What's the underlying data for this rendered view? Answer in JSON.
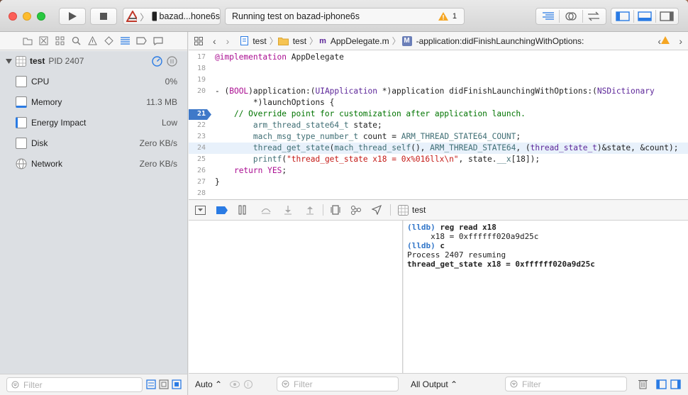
{
  "toolbar": {
    "scheme_target": "bazad...hone6s",
    "activity_text": "Running test on bazad-iphone6s",
    "warning_count": "1"
  },
  "navigator": {
    "process": {
      "name": "test",
      "pid": "PID 2407"
    },
    "gauges": [
      {
        "label": "CPU",
        "value": "0%"
      },
      {
        "label": "Memory",
        "value": "11.3 MB"
      },
      {
        "label": "Energy Impact",
        "value": "Low"
      },
      {
        "label": "Disk",
        "value": "Zero KB/s"
      },
      {
        "label": "Network",
        "value": "Zero KB/s"
      }
    ],
    "filter_placeholder": "Filter"
  },
  "jumpbar": {
    "project": "test",
    "group": "test",
    "file": "AppDelegate.m",
    "method": "-application:didFinishLaunchingWithOptions:"
  },
  "editor": {
    "lines": [
      {
        "n": "17",
        "text": "@implementation AppDelegate"
      },
      {
        "n": "18",
        "text": ""
      },
      {
        "n": "19",
        "text": ""
      },
      {
        "n": "20",
        "text": "- (BOOL)application:(UIApplication *)application didFinishLaunchingWithOptions:(NSDictionary"
      },
      {
        "n": "",
        "text": "        *)launchOptions {"
      },
      {
        "n": "21",
        "text": "    // Override point for customization after application launch."
      },
      {
        "n": "22",
        "text": "        arm_thread_state64_t state;"
      },
      {
        "n": "23",
        "text": "        mach_msg_type_number_t count = ARM_THREAD_STATE64_COUNT;"
      },
      {
        "n": "24",
        "text": "        thread_get_state(mach_thread_self(), ARM_THREAD_STATE64, (thread_state_t)&state, &count);"
      },
      {
        "n": "25",
        "text": "        printf(\"thread_get_state x18 = 0x%016llx\\n\", state.__x[18]);"
      },
      {
        "n": "26",
        "text": "    return YES;"
      },
      {
        "n": "27",
        "text": "}"
      },
      {
        "n": "28",
        "text": ""
      }
    ],
    "breakpoint_line": "21",
    "current_line": "24"
  },
  "debugbar": {
    "thread_label": "test"
  },
  "console": {
    "lines": [
      {
        "prompt": "(lldb)",
        "text": " reg read x18",
        "bold": true
      },
      {
        "prompt": "",
        "text": "     x18 = 0xffffff020a9d25c",
        "bold": false
      },
      {
        "prompt": "(lldb)",
        "text": " c",
        "bold": true
      },
      {
        "prompt": "",
        "text": "Process 2407 resuming",
        "bold": false
      },
      {
        "prompt": "",
        "text": "thread_get_state x18 = 0xffffff020a9d25c",
        "bold": true
      }
    ]
  },
  "bottom": {
    "auto_label": "Auto",
    "vars_filter": "Filter",
    "output_label": "All Output",
    "console_filter": "Filter"
  }
}
